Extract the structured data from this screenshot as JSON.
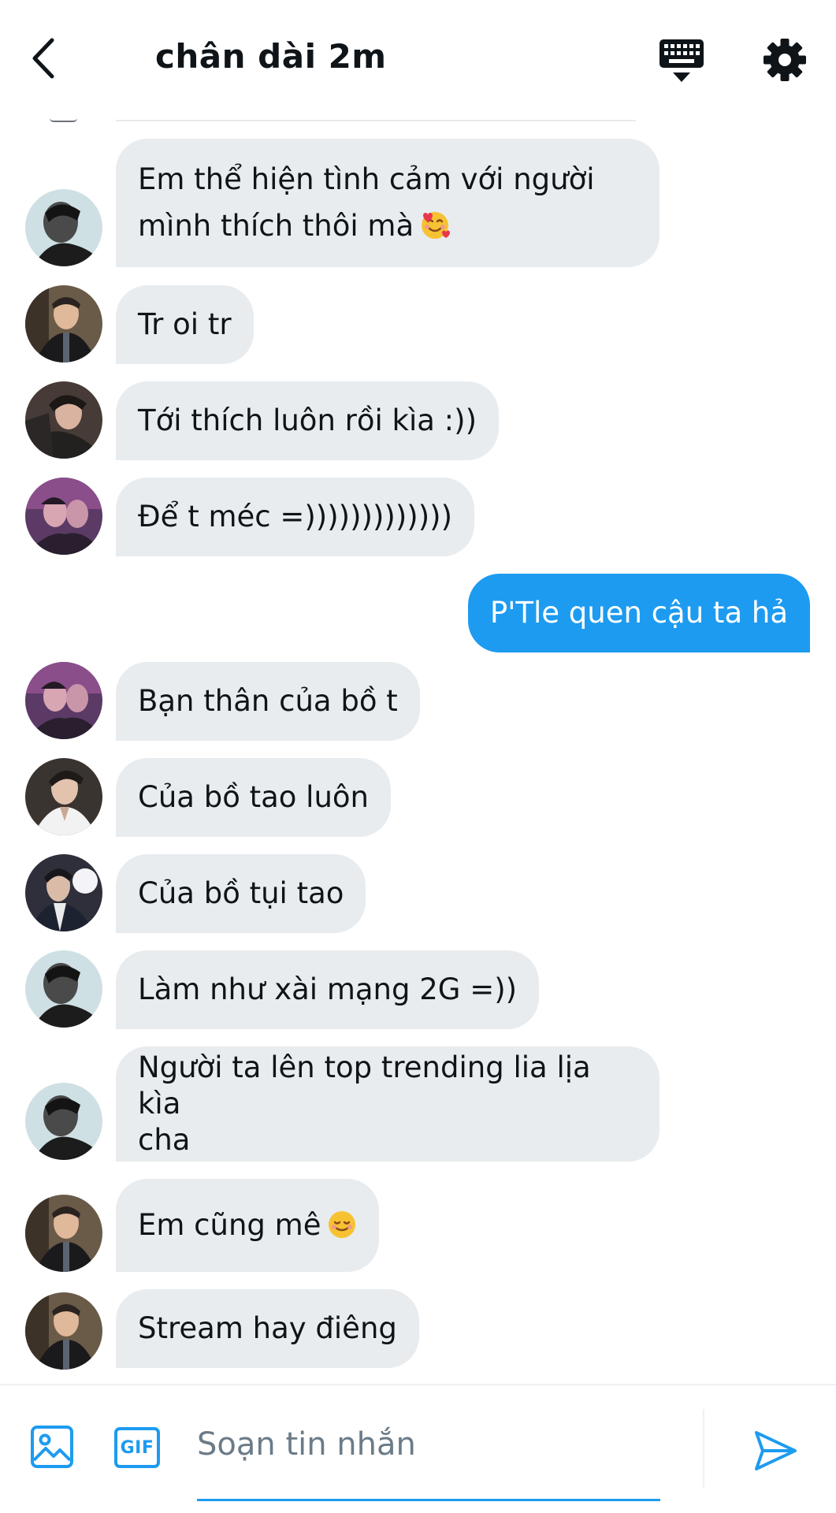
{
  "header": {
    "title": "chân dài 2m",
    "back_icon": "chevron-left-icon",
    "keyboard_icon": "keyboard-icon",
    "settings_icon": "gear-icon"
  },
  "messages": [
    {
      "direction": "received",
      "lines": [
        "Em thể hiện tình cảm với người",
        "mình thích thôi mà"
      ],
      "emoji": "smiling-face-with-hearts"
    },
    {
      "direction": "received",
      "text": "Tr oi tr"
    },
    {
      "direction": "received",
      "text": "Tới thích luôn rồi kìa :))"
    },
    {
      "direction": "received",
      "text": "Để t méc =)))))))))))))"
    },
    {
      "direction": "sent",
      "text": "P'Tle quen cậu ta hả"
    },
    {
      "direction": "received",
      "text": "Bạn thân của bồ t"
    },
    {
      "direction": "received",
      "text": "Của bồ tao luôn"
    },
    {
      "direction": "received",
      "text": "Của bồ tụi tao"
    },
    {
      "direction": "received",
      "text": "Làm như xài mạng 2G =))"
    },
    {
      "direction": "received",
      "lines": [
        "Người ta lên top trending lia lịa kìa",
        "cha"
      ]
    },
    {
      "direction": "received",
      "text": "Em cũng mê",
      "emoji": "smiling-face"
    },
    {
      "direction": "received",
      "text": "Stream hay điêng"
    }
  ],
  "composer": {
    "placeholder": "Soạn tin nhắn",
    "gif_label": "GIF",
    "image_icon": "image-icon",
    "send_icon": "send-icon"
  },
  "colors": {
    "accent": "#1d9bf0",
    "received_bubble": "#e8ecef",
    "text": "#0f1419",
    "placeholder": "#6b7b88"
  }
}
